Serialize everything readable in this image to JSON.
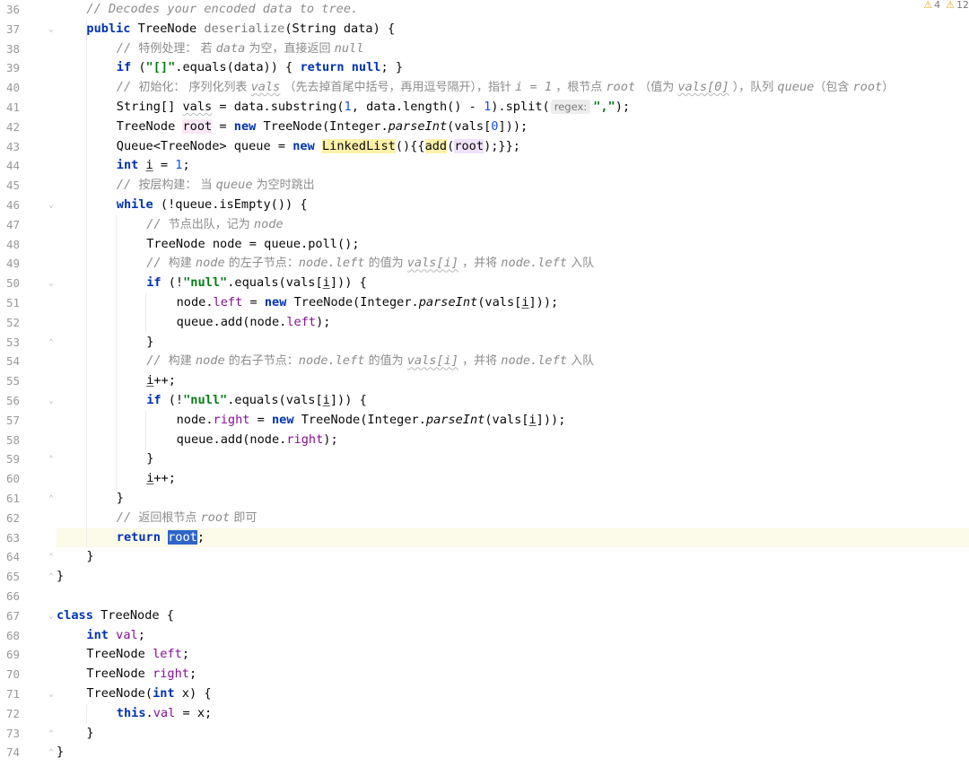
{
  "warnings": [
    {
      "icon": "warning-icon",
      "count": "4"
    },
    {
      "icon": "warning-icon",
      "count": "12"
    }
  ],
  "colors": {
    "keyword": "#0033b3",
    "comment": "#8c8c8c",
    "string": "#067d17",
    "number": "#1750eb",
    "field": "#871094",
    "current_line": "#fcfae8",
    "selection": "#2f65ca"
  },
  "current_line": "63",
  "lines": [
    {
      "n": "36",
      "indent": 1,
      "tokens": [
        {
          "t": "// Decodes your encoded data to tree.",
          "c": "cmt"
        }
      ]
    },
    {
      "n": "37",
      "indent": 1,
      "fold": "open",
      "tokens": [
        {
          "t": "public",
          "c": "kw"
        },
        {
          "t": " TreeNode "
        },
        {
          "t": "deserialize",
          "c": "meth-unused"
        },
        {
          "t": "(String data) {"
        }
      ]
    },
    {
      "n": "38",
      "indent": 2,
      "tokens": [
        {
          "t": "// ",
          "c": "cmt"
        },
        {
          "t": "特例处理： 若 ",
          "c": "cmt-cn"
        },
        {
          "t": "data",
          "c": "cmt"
        },
        {
          "t": " 为空，直接返回 ",
          "c": "cmt-cn"
        },
        {
          "t": "null",
          "c": "cmt"
        }
      ]
    },
    {
      "n": "39",
      "indent": 2,
      "tokens": [
        {
          "t": "if",
          "c": "kw"
        },
        {
          "t": " ("
        },
        {
          "t": "\"[]\"",
          "c": "str"
        },
        {
          "t": ".equals(data)) { "
        },
        {
          "t": "return null",
          "c": "kw"
        },
        {
          "t": "; }"
        }
      ]
    },
    {
      "n": "40",
      "indent": 2,
      "tokens": [
        {
          "t": "// ",
          "c": "cmt"
        },
        {
          "t": "初始化： 序列化列表 ",
          "c": "cmt-cn"
        },
        {
          "t": "vals",
          "c": "cmt wavy"
        },
        {
          "t": " （先去掉首尾中括号，再用逗号隔开），指针 ",
          "c": "cmt-cn"
        },
        {
          "t": "i = 1",
          "c": "cmt"
        },
        {
          "t": " ，根节点 ",
          "c": "cmt-cn"
        },
        {
          "t": "root",
          "c": "cmt"
        },
        {
          "t": " （值为 ",
          "c": "cmt-cn"
        },
        {
          "t": "vals[0]",
          "c": "cmt wavy"
        },
        {
          "t": " ），队列 ",
          "c": "cmt-cn"
        },
        {
          "t": "queue",
          "c": "cmt"
        },
        {
          "t": "（包含 ",
          "c": "cmt-cn"
        },
        {
          "t": "root",
          "c": "cmt"
        },
        {
          "t": "）",
          "c": "cmt-cn"
        }
      ]
    },
    {
      "n": "41",
      "indent": 2,
      "tokens": [
        {
          "t": "String[] "
        },
        {
          "t": "vals",
          "c": "wavy"
        },
        {
          "t": " = data.substring("
        },
        {
          "t": "1",
          "c": "num"
        },
        {
          "t": ", data.length() - "
        },
        {
          "t": "1",
          "c": "num"
        },
        {
          "t": ").split("
        },
        {
          "t": "regex:",
          "c": "hint"
        },
        {
          "t": "\",\"",
          "c": "str"
        },
        {
          "t": ");"
        }
      ]
    },
    {
      "n": "42",
      "indent": 2,
      "tokens": [
        {
          "t": "TreeNode "
        },
        {
          "t": "root",
          "c": "hl-pink"
        },
        {
          "t": " = "
        },
        {
          "t": "new",
          "c": "kw"
        },
        {
          "t": " TreeNode(Integer."
        },
        {
          "t": "parseInt",
          "c": "stat"
        },
        {
          "t": "(vals["
        },
        {
          "t": "0",
          "c": "num"
        },
        {
          "t": "]));"
        }
      ]
    },
    {
      "n": "43",
      "indent": 2,
      "tokens": [
        {
          "t": "Queue<TreeNode> queue = "
        },
        {
          "t": "new",
          "c": "kw"
        },
        {
          "t": " "
        },
        {
          "t": "LinkedList",
          "c": "hl-yellow"
        },
        {
          "t": "(){{"
        },
        {
          "t": "add",
          "c": "hl-yellow"
        },
        {
          "t": "("
        },
        {
          "t": "root",
          "c": "hl-purple"
        },
        {
          "t": ");}};"
        }
      ]
    },
    {
      "n": "44",
      "indent": 2,
      "tokens": [
        {
          "t": "int",
          "c": "kw"
        },
        {
          "t": " "
        },
        {
          "t": "i",
          "c": "uline"
        },
        {
          "t": " = "
        },
        {
          "t": "1",
          "c": "num"
        },
        {
          "t": ";"
        }
      ]
    },
    {
      "n": "45",
      "indent": 2,
      "tokens": [
        {
          "t": "// ",
          "c": "cmt"
        },
        {
          "t": "按层构建： 当 ",
          "c": "cmt-cn"
        },
        {
          "t": "queue",
          "c": "cmt"
        },
        {
          "t": " 为空时跳出",
          "c": "cmt-cn"
        }
      ]
    },
    {
      "n": "46",
      "indent": 2,
      "fold": "open",
      "tokens": [
        {
          "t": "while",
          "c": "kw"
        },
        {
          "t": " (!queue.isEmpty()) {"
        }
      ]
    },
    {
      "n": "47",
      "indent": 3,
      "tokens": [
        {
          "t": "// ",
          "c": "cmt"
        },
        {
          "t": "节点出队，记为 ",
          "c": "cmt-cn"
        },
        {
          "t": "node",
          "c": "cmt"
        }
      ]
    },
    {
      "n": "48",
      "indent": 3,
      "tokens": [
        {
          "t": "TreeNode node = queue.poll();"
        }
      ]
    },
    {
      "n": "49",
      "indent": 3,
      "tokens": [
        {
          "t": "// ",
          "c": "cmt"
        },
        {
          "t": "构建 ",
          "c": "cmt-cn"
        },
        {
          "t": "node",
          "c": "cmt"
        },
        {
          "t": " 的左子节点：",
          "c": "cmt-cn"
        },
        {
          "t": "node.left",
          "c": "cmt"
        },
        {
          "t": " 的值为 ",
          "c": "cmt-cn"
        },
        {
          "t": "vals[i]",
          "c": "cmt wavy"
        },
        {
          "t": " ，并将 ",
          "c": "cmt-cn"
        },
        {
          "t": "node.left",
          "c": "cmt"
        },
        {
          "t": " 入队",
          "c": "cmt-cn"
        }
      ]
    },
    {
      "n": "50",
      "indent": 3,
      "fold": "open",
      "tokens": [
        {
          "t": "if",
          "c": "kw"
        },
        {
          "t": " (!"
        },
        {
          "t": "\"null\"",
          "c": "str"
        },
        {
          "t": ".equals(vals["
        },
        {
          "t": "i",
          "c": "uline"
        },
        {
          "t": "])) {"
        }
      ]
    },
    {
      "n": "51",
      "indent": 4,
      "tokens": [
        {
          "t": "node."
        },
        {
          "t": "left",
          "c": "fld"
        },
        {
          "t": " = "
        },
        {
          "t": "new",
          "c": "kw"
        },
        {
          "t": " TreeNode(Integer."
        },
        {
          "t": "parseInt",
          "c": "stat"
        },
        {
          "t": "(vals["
        },
        {
          "t": "i",
          "c": "uline"
        },
        {
          "t": "]));"
        }
      ]
    },
    {
      "n": "52",
      "indent": 4,
      "tokens": [
        {
          "t": "queue.add(node."
        },
        {
          "t": "left",
          "c": "fld"
        },
        {
          "t": ");"
        }
      ]
    },
    {
      "n": "53",
      "indent": 3,
      "fold": "close",
      "tokens": [
        {
          "t": "}"
        }
      ]
    },
    {
      "n": "54",
      "indent": 3,
      "tokens": [
        {
          "t": "// ",
          "c": "cmt"
        },
        {
          "t": "构建 ",
          "c": "cmt-cn"
        },
        {
          "t": "node",
          "c": "cmt"
        },
        {
          "t": " 的右子节点：",
          "c": "cmt-cn"
        },
        {
          "t": "node.left",
          "c": "cmt"
        },
        {
          "t": " 的值为 ",
          "c": "cmt-cn"
        },
        {
          "t": "vals[i]",
          "c": "cmt wavy"
        },
        {
          "t": " ，并将 ",
          "c": "cmt-cn"
        },
        {
          "t": "node.left",
          "c": "cmt"
        },
        {
          "t": " 入队",
          "c": "cmt-cn"
        }
      ]
    },
    {
      "n": "55",
      "indent": 3,
      "tokens": [
        {
          "t": "i",
          "c": "uline"
        },
        {
          "t": "++;"
        }
      ]
    },
    {
      "n": "56",
      "indent": 3,
      "fold": "open",
      "tokens": [
        {
          "t": "if",
          "c": "kw"
        },
        {
          "t": " (!"
        },
        {
          "t": "\"null\"",
          "c": "str"
        },
        {
          "t": ".equals(vals["
        },
        {
          "t": "i",
          "c": "uline"
        },
        {
          "t": "])) {"
        }
      ]
    },
    {
      "n": "57",
      "indent": 4,
      "tokens": [
        {
          "t": "node."
        },
        {
          "t": "right",
          "c": "fld"
        },
        {
          "t": " = "
        },
        {
          "t": "new",
          "c": "kw"
        },
        {
          "t": " TreeNode(Integer."
        },
        {
          "t": "parseInt",
          "c": "stat"
        },
        {
          "t": "(vals["
        },
        {
          "t": "i",
          "c": "uline"
        },
        {
          "t": "]));"
        }
      ]
    },
    {
      "n": "58",
      "indent": 4,
      "tokens": [
        {
          "t": "queue.add(node."
        },
        {
          "t": "right",
          "c": "fld"
        },
        {
          "t": ");"
        }
      ]
    },
    {
      "n": "59",
      "indent": 3,
      "fold": "close",
      "tokens": [
        {
          "t": "}"
        }
      ]
    },
    {
      "n": "60",
      "indent": 3,
      "tokens": [
        {
          "t": "i",
          "c": "uline"
        },
        {
          "t": "++;"
        }
      ]
    },
    {
      "n": "61",
      "indent": 2,
      "fold": "close",
      "tokens": [
        {
          "t": "}"
        }
      ]
    },
    {
      "n": "62",
      "indent": 2,
      "tokens": [
        {
          "t": "// ",
          "c": "cmt"
        },
        {
          "t": "返回根节点 ",
          "c": "cmt-cn"
        },
        {
          "t": "root",
          "c": "cmt"
        },
        {
          "t": " 即可",
          "c": "cmt-cn"
        }
      ]
    },
    {
      "n": "63",
      "indent": 2,
      "tokens": [
        {
          "t": "return",
          "c": "kw"
        },
        {
          "t": " "
        },
        {
          "t": "root",
          "c": "hl-sel"
        },
        {
          "t": ";"
        }
      ]
    },
    {
      "n": "64",
      "indent": 1,
      "fold": "close",
      "tokens": [
        {
          "t": "}"
        }
      ]
    },
    {
      "n": "65",
      "indent": 0,
      "fold": "close",
      "tokens": [
        {
          "t": "}"
        }
      ]
    },
    {
      "n": "66",
      "indent": 0,
      "tokens": []
    },
    {
      "n": "67",
      "indent": 0,
      "fold": "open",
      "tokens": [
        {
          "t": "class",
          "c": "kw"
        },
        {
          "t": " TreeNode {"
        }
      ]
    },
    {
      "n": "68",
      "indent": 1,
      "tokens": [
        {
          "t": "int",
          "c": "kw"
        },
        {
          "t": " "
        },
        {
          "t": "val",
          "c": "fld"
        },
        {
          "t": ";"
        }
      ]
    },
    {
      "n": "69",
      "indent": 1,
      "tokens": [
        {
          "t": "TreeNode "
        },
        {
          "t": "left",
          "c": "fld"
        },
        {
          "t": ";"
        }
      ]
    },
    {
      "n": "70",
      "indent": 1,
      "tokens": [
        {
          "t": "TreeNode "
        },
        {
          "t": "right",
          "c": "fld"
        },
        {
          "t": ";"
        }
      ]
    },
    {
      "n": "71",
      "indent": 1,
      "fold": "open",
      "tokens": [
        {
          "t": "TreeNode("
        },
        {
          "t": "int",
          "c": "kw"
        },
        {
          "t": " x) {"
        }
      ]
    },
    {
      "n": "72",
      "indent": 2,
      "tokens": [
        {
          "t": "this",
          "c": "kw"
        },
        {
          "t": "."
        },
        {
          "t": "val",
          "c": "fld"
        },
        {
          "t": " = x;"
        }
      ]
    },
    {
      "n": "73",
      "indent": 1,
      "fold": "close",
      "tokens": [
        {
          "t": "}"
        }
      ]
    },
    {
      "n": "74",
      "indent": 0,
      "fold": "close",
      "tokens": [
        {
          "t": "}"
        }
      ]
    }
  ]
}
